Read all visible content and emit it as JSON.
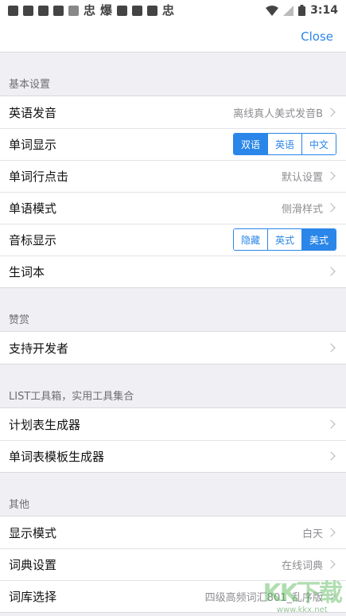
{
  "status_bar": {
    "time": "3:14",
    "left_icons": [
      "notification-icon",
      "app-icon",
      "app-icon",
      "app-icon",
      "app-icon",
      "app-icon",
      "app-icon",
      "app-icon",
      "app-icon",
      "app-icon"
    ]
  },
  "nav": {
    "close_label": "Close"
  },
  "sections": {
    "basic": {
      "title": "基本设置",
      "english_pron": {
        "label": "英语发音",
        "value": "离线真人美式发音B"
      },
      "word_display": {
        "label": "单词显示",
        "options": [
          "双语",
          "英语",
          "中文"
        ],
        "selected": "双语"
      },
      "word_tap": {
        "label": "单词行点击",
        "value": "默认设置"
      },
      "word_mode": {
        "label": "单语模式",
        "value": "侧滑样式"
      },
      "phonetic": {
        "label": "音标显示",
        "options": [
          "隐藏",
          "英式",
          "美式"
        ],
        "selected": "美式"
      },
      "vocab_book": {
        "label": "生词本"
      }
    },
    "donate": {
      "title": "赞赏",
      "support_dev": {
        "label": "支持开发者"
      }
    },
    "tools": {
      "title": "LIST工具箱，实用工具集合",
      "plan_gen": {
        "label": "计划表生成器"
      },
      "template_gen": {
        "label": "单词表模板生成器"
      }
    },
    "other": {
      "title": "其他",
      "display_mode": {
        "label": "显示模式",
        "value": "白天"
      },
      "dict_settings": {
        "label": "词典设置",
        "value": "在线词典"
      },
      "lexicon": {
        "label": "词库选择",
        "value": "四级高频词汇801_乱序版"
      }
    }
  },
  "watermark": {
    "big": "KK下载",
    "small": "www.kkx.net"
  },
  "colors": {
    "accent": "#2a86e8",
    "background": "#efeff4"
  }
}
